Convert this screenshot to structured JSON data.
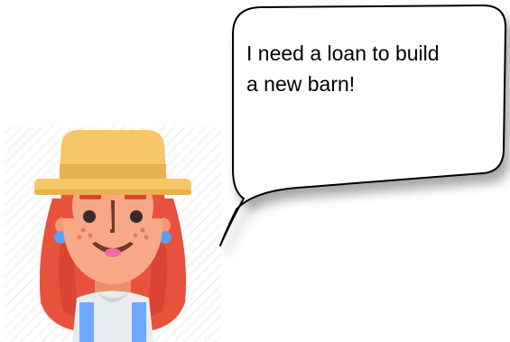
{
  "speech_bubble": {
    "text": "I need a loan to build\na new barn!"
  },
  "character": {
    "icon": "farmer-woman-avatar-icon",
    "hat_color": "#f7c667",
    "hair_color": "#e8523c",
    "skin_color": "#f7a987",
    "overalls_color": "#6ea8fe"
  }
}
